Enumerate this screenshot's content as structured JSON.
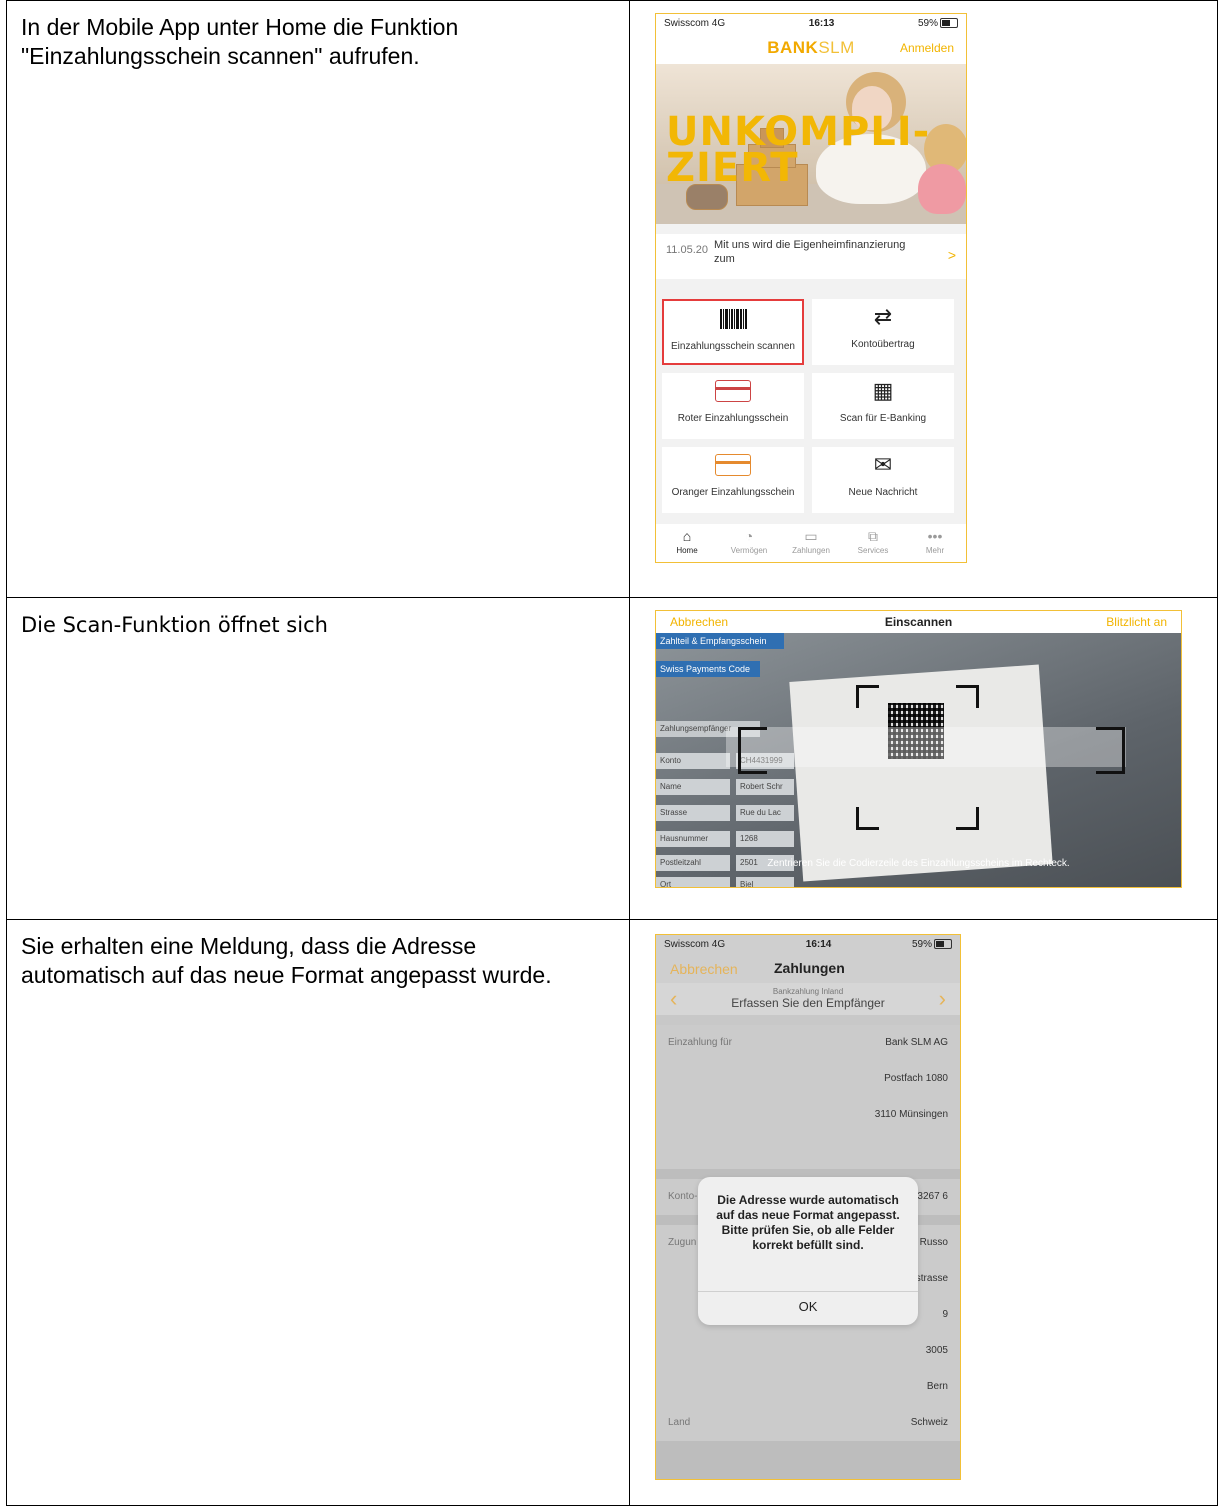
{
  "steps": [
    {
      "text": "In der Mobile App unter Home die Funktion \"Einzahlungsschein scannen\" aufrufen."
    },
    {
      "text": "Die Scan-Funktion öffnet sich"
    },
    {
      "text": "Sie erhalten eine Meldung, dass die Adresse automatisch auf das neue Format angepasst wurde."
    }
  ],
  "screen1": {
    "status": {
      "carrier": "Swisscom 4G",
      "time": "16:13",
      "battery": "59%"
    },
    "brand_bold": "BANK",
    "brand_light": "SLM",
    "login": "Anmelden",
    "slogan_line1": "UNKOMPLI-",
    "slogan_line2": "ZIERT",
    "news": {
      "date": "11.05.20",
      "text": "Mit uns wird die Eigenheimfinanzierung zum",
      "chevron": ">"
    },
    "tiles": [
      {
        "label": "Einzahlungsschein scannen",
        "icon": "barcode-icon"
      },
      {
        "label": "Kontoübertrag",
        "icon": "transfer-icon"
      },
      {
        "label": "Roter Einzahlungsschein",
        "icon": "red-card-icon"
      },
      {
        "label": "Scan für E-Banking",
        "icon": "qr-code-icon"
      },
      {
        "label": "Oranger Einzahlungsschein",
        "icon": "orange-card-icon"
      },
      {
        "label": "Neue Nachricht",
        "icon": "secure-mail-icon"
      }
    ],
    "tabs": [
      {
        "label": "Home",
        "glyph": "⌂"
      },
      {
        "label": "Vermögen",
        "glyph": "◔"
      },
      {
        "label": "Zahlungen",
        "glyph": "▭"
      },
      {
        "label": "Services",
        "glyph": "⧉"
      },
      {
        "label": "Mehr",
        "glyph": "•••"
      }
    ]
  },
  "screen2": {
    "cancel": "Abbrechen",
    "title": "Einscannen",
    "flash": "Blitzlicht an",
    "hint": "Zentrieren Sie die Codierzeile des Einzahlungsscheins im Rechteck.",
    "background_labels": [
      "Zahlteil & Empfangsschein",
      "Swiss Payments Code",
      "Zahlungsempfänger",
      "Konto",
      "Name",
      "Strasse",
      "Hausnummer",
      "Postleitzahl",
      "Ort"
    ],
    "background_values": [
      "CH4431999",
      "Robert Schr",
      "Rue du Lac",
      "1268",
      "2501",
      "Biel"
    ]
  },
  "screen3": {
    "status": {
      "carrier": "Swisscom 4G",
      "time": "16:14",
      "battery": "59%"
    },
    "cancel": "Abbrechen",
    "title": "Zahlungen",
    "sub_small": "Bankzahlung Inland",
    "sub_title": "Erfassen Sie den Empfänger",
    "rows": [
      {
        "k": "Einzahlung für",
        "v": "Bank SLM AG"
      },
      {
        "k": "",
        "v": "Postfach 1080"
      },
      {
        "k": "",
        "v": "3110 Münsingen"
      },
      {
        "k": "",
        "v": ""
      },
      {
        "k": "Konto-",
        "v": "3267 6"
      },
      {
        "k": "Zugun",
        "v": "Russo"
      },
      {
        "k": "",
        "v": "Helvetiastrasse"
      },
      {
        "k": "",
        "v": "9"
      },
      {
        "k": "",
        "v": "3005"
      },
      {
        "k": "",
        "v": "Bern"
      },
      {
        "k": "Land",
        "v": "Schweiz"
      }
    ],
    "dialog": {
      "message": "Die Adresse wurde automatisch auf das neue Format angepasst. Bitte prüfen Sie, ob alle Felder korrekt befüllt sind.",
      "ok": "OK"
    }
  }
}
